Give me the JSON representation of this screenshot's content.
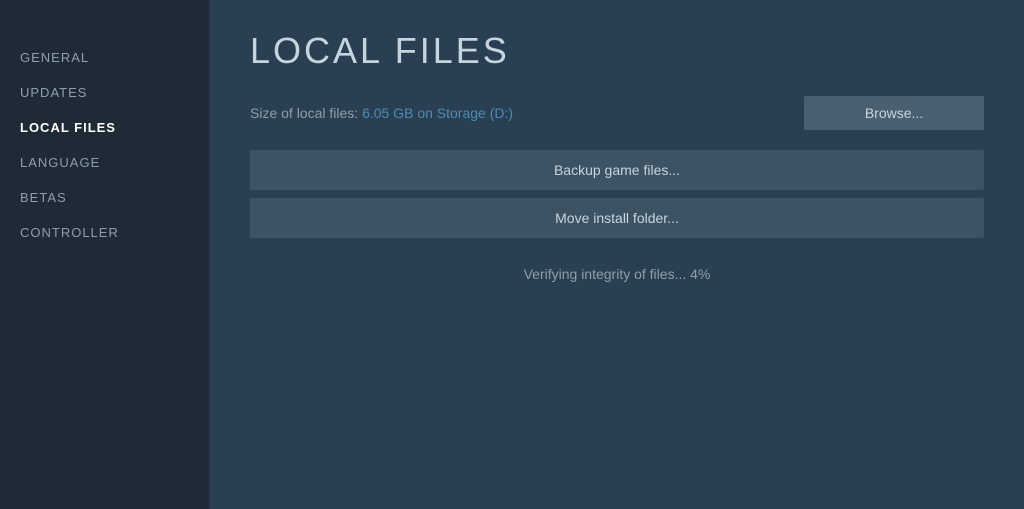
{
  "sidebar": {
    "items": [
      {
        "id": "general",
        "label": "GENERAL",
        "active": false
      },
      {
        "id": "updates",
        "label": "UPDATES",
        "active": false
      },
      {
        "id": "local-files",
        "label": "LOCAL FILES",
        "active": true
      },
      {
        "id": "language",
        "label": "LANGUAGE",
        "active": false
      },
      {
        "id": "betas",
        "label": "BETAS",
        "active": false
      },
      {
        "id": "controller",
        "label": "CONTROLLER",
        "active": false
      }
    ]
  },
  "main": {
    "title": "LOCAL FILES",
    "file_size_label": "Size of local files:",
    "file_size_value": "6.05 GB on Storage (D:)",
    "browse_label": "Browse...",
    "backup_label": "Backup game files...",
    "move_label": "Move install folder...",
    "verify_text": "Verifying integrity of files... 4%"
  }
}
